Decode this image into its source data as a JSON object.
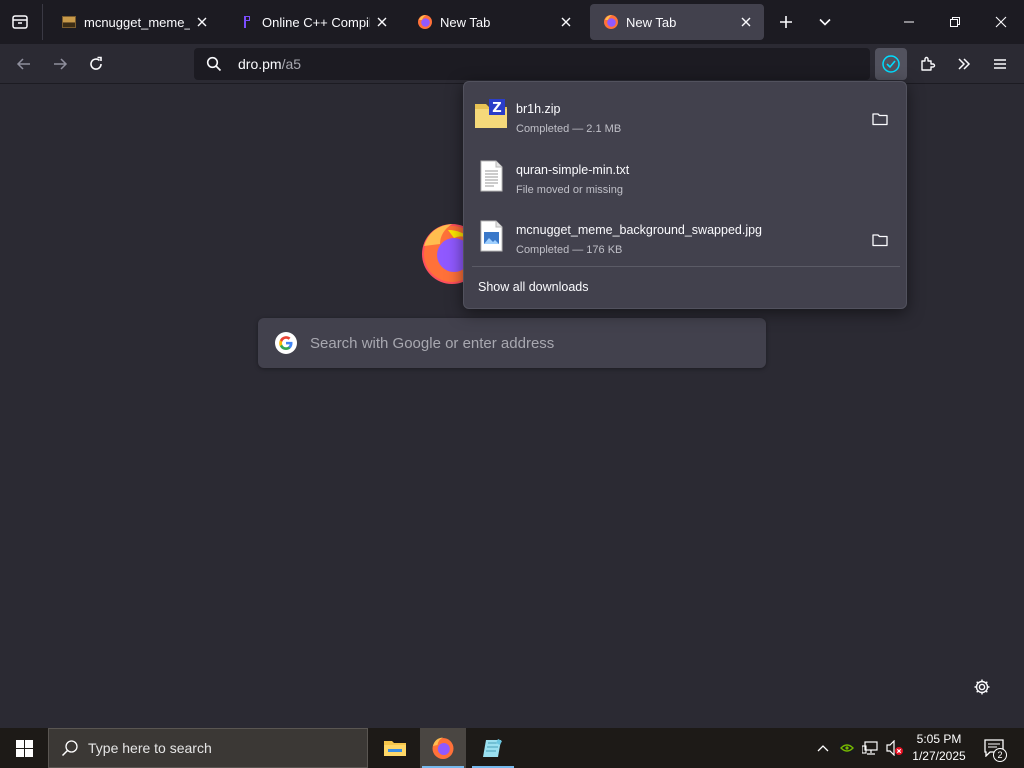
{
  "tabs": [
    {
      "title": "mcnugget_meme_back",
      "favicon": "image-icon",
      "active": false
    },
    {
      "title": "Online C++ Compiler -",
      "favicon": "compiler-icon",
      "active": false
    },
    {
      "title": "New Tab",
      "favicon": "firefox-icon",
      "active": false
    },
    {
      "title": "New Tab",
      "favicon": "firefox-icon",
      "active": true
    }
  ],
  "urlbar": {
    "host": "dro.pm",
    "path": "/a5"
  },
  "newtab": {
    "search_placeholder": "Search with Google or enter address"
  },
  "downloads": {
    "items": [
      {
        "name": "br1h.zip",
        "status": "Completed — 2.1 MB",
        "icon": "zip-file-icon",
        "has_folder": true
      },
      {
        "name": "quran-simple-min.txt",
        "status": "File moved or missing",
        "icon": "text-file-icon",
        "has_folder": false
      },
      {
        "name": "mcnugget_meme_background_swapped.jpg",
        "status": "Completed — 176 KB",
        "icon": "image-file-icon",
        "has_folder": true
      }
    ],
    "show_all_label": "Show all downloads"
  },
  "taskbar": {
    "search_placeholder": "Type here to search",
    "time": "5:05 PM",
    "date": "1/27/2025",
    "notification_count": "2"
  },
  "colors": {
    "tabstrip_bg": "#1c1b22",
    "content_bg": "#2b2a33",
    "active_tab": "#42414d",
    "panel_bg": "#42414d",
    "taskbar_bg": "#1d1a17",
    "accent": "#00ddff"
  }
}
